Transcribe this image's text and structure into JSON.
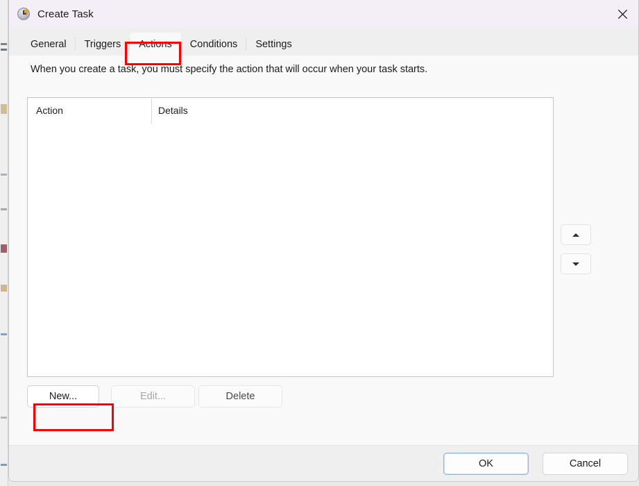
{
  "window": {
    "title": "Create Task",
    "icon": "task-scheduler-clock-icon",
    "close_label": "✕"
  },
  "tabs": [
    {
      "label": "General",
      "selected": false
    },
    {
      "label": "Triggers",
      "selected": false
    },
    {
      "label": "Actions",
      "selected": true
    },
    {
      "label": "Conditions",
      "selected": false
    },
    {
      "label": "Settings",
      "selected": false
    }
  ],
  "content": {
    "instruction": "When you create a task, you must specify the action that will occur when your task starts.",
    "list": {
      "columns": [
        "Action",
        "Details"
      ],
      "rows": []
    },
    "reorder": {
      "move_up_label": "▲",
      "move_down_label": "▼"
    },
    "buttons": {
      "new": "New...",
      "edit": "Edit...",
      "delete": "Delete"
    }
  },
  "footer": {
    "ok": "OK",
    "cancel": "Cancel"
  },
  "annotations": {
    "color": "#fa0000",
    "targets": [
      "Actions",
      "New..."
    ]
  }
}
